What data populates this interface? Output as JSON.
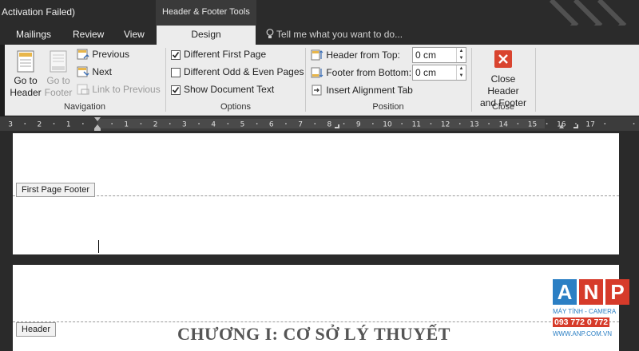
{
  "titlebar": {
    "doc_title": "Activation Failed)",
    "context_group": "Header & Footer Tools"
  },
  "tabs": {
    "mailings": "Mailings",
    "review": "Review",
    "view": "View",
    "design": "Design",
    "tell_me": "Tell me what you want to do..."
  },
  "ribbon": {
    "navigation": {
      "go_to_header": [
        "Go to",
        "Header"
      ],
      "go_to_footer": [
        "Go to",
        "Footer"
      ],
      "previous": "Previous",
      "next": "Next",
      "link_to_previous": "Link to Previous",
      "label": "Navigation"
    },
    "options": {
      "different_first_page": "Different First Page",
      "different_first_page_checked": true,
      "different_odd_even": "Different Odd & Even Pages",
      "different_odd_even_checked": false,
      "show_document_text": "Show Document Text",
      "show_document_text_checked": true,
      "label": "Options"
    },
    "position": {
      "header_from_top": "Header from Top:",
      "header_from_top_value": "0 cm",
      "footer_from_bottom": "Footer from Bottom:",
      "footer_from_bottom_value": "0 cm",
      "insert_alignment_tab": "Insert Alignment Tab",
      "label": "Position"
    },
    "close": {
      "close_header_footer": [
        "Close Header",
        "and Footer"
      ],
      "label": "Close"
    }
  },
  "ruler": {
    "labels": [
      "3",
      "2",
      "1",
      "1",
      "2",
      "3",
      "4",
      "5",
      "6",
      "7",
      "8",
      "9",
      "10",
      "11",
      "12",
      "13",
      "14",
      "15",
      "16",
      "17"
    ]
  },
  "document": {
    "first_page_footer_tag": "First Page Footer",
    "header_tag": "Header",
    "chapter_heading": "CHƯƠNG I: CƠ SỞ LÝ THUYẾT"
  },
  "watermark": {
    "letters": [
      "A",
      "N",
      "P"
    ],
    "tagline": "MÁY TÍNH - CAMERA",
    "phone": "093 772 0 772",
    "website": "WWW.ANP.COM.VN"
  },
  "colors": {
    "accent_close": "#d9442f",
    "ribbon_bg": "#ececec",
    "dark_chrome": "#2b2b2b",
    "logo_blue": "#2b7fc4",
    "logo_red": "#d63b2a"
  }
}
